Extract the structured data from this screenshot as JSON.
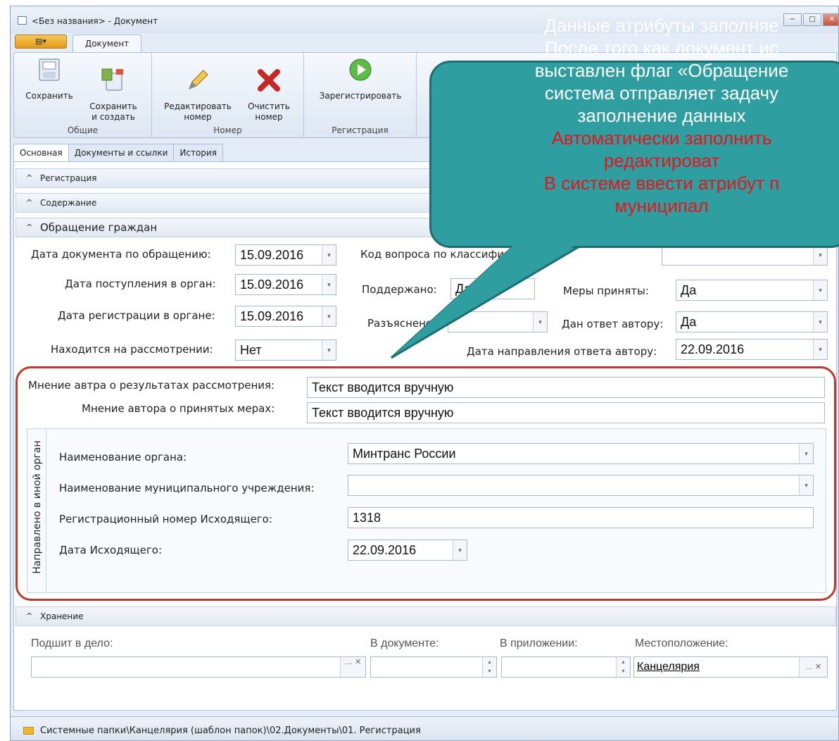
{
  "window": {
    "title": "<Без названия> - Документ",
    "min": "−",
    "max": "□",
    "close": "✕"
  },
  "ribbon": {
    "app_button": "▤▾",
    "tab": "Документ",
    "groups": [
      {
        "label": "Общие",
        "buttons": [
          "Сохранить",
          "Сохранить\nи создать"
        ]
      },
      {
        "label": "Номер",
        "buttons": [
          "Редактировать\nномер",
          "Очистить\nномер"
        ]
      },
      {
        "label": "Регистрация",
        "buttons": [
          "Зарегистрировать"
        ]
      }
    ]
  },
  "tabs": [
    "Основная",
    "Документы и ссылки",
    "История"
  ],
  "sections": {
    "registration": "Регистрация",
    "content": "Содержание",
    "appeal": "Обращение граждан",
    "storage": "Хранение"
  },
  "appeal": {
    "doc_date_label": "Дата документа по обращению:",
    "doc_date": "15.09.2016",
    "received_label": "Дата поступления в орган:",
    "received": "15.09.2016",
    "reg_date_label": "Дата регистрации в органе:",
    "reg_date": "15.09.2016",
    "under_review_label": "Находится на рассмотрении:",
    "under_review": "Нет",
    "question_code_label": "Код вопроса по классификатору:",
    "supported_label": "Поддержано:",
    "supported": "Да",
    "measures_label": "Меры приняты:",
    "measures": "Да",
    "explained_label": "Разъяснено:",
    "answered_label": "Дан ответ автору:",
    "answered": "Да",
    "answer_date_label": "Дата направления ответа автору:",
    "answer_date": "22.09.2016",
    "opinion_result_label": "Мнение автра о результатах рассмотрения:",
    "opinion_result": "Текст вводится вручную",
    "opinion_measures_label": "Мнение автора о принятых мерах:",
    "opinion_measures": "Текст вводится вручную"
  },
  "sent": {
    "group_label": "Направлено в иной орган",
    "org_label": "Наименование органа:",
    "org": "Минтранс России",
    "muni_label": "Наименование муниципального учреждения:",
    "muni": "",
    "outgoing_no_label": "Регистрационный номер Исходящего:",
    "outgoing_no": "1318",
    "outgoing_date_label": "Дата Исходящего:",
    "outgoing_date": "22.09.2016"
  },
  "storage": {
    "case_label": "Подшит в дело:",
    "in_doc_label": "В документе:",
    "in_attach_label": "В приложении:",
    "location_label": "Местоположение:",
    "location": "Канцелярия"
  },
  "status": {
    "path": "Системные папки\\Канцелярия (шаблон папок)\\02.Документы\\01. Регистрация"
  },
  "callout": {
    "white_lines": [
      "Данные атрибуты заполняе",
      "После того как документ ис",
      "выставлен флаг «Обращение",
      "система отправляет задачу",
      "заполнение данных"
    ],
    "red_lines": [
      "Автоматически заполнить",
      "редактироват",
      "В системе ввести атрибут п",
      "муниципал"
    ]
  },
  "colors": {
    "callout_fill": "#2e9ea1",
    "highlight_frame": "#c0392b",
    "callout_red_text": "#e8141a"
  }
}
